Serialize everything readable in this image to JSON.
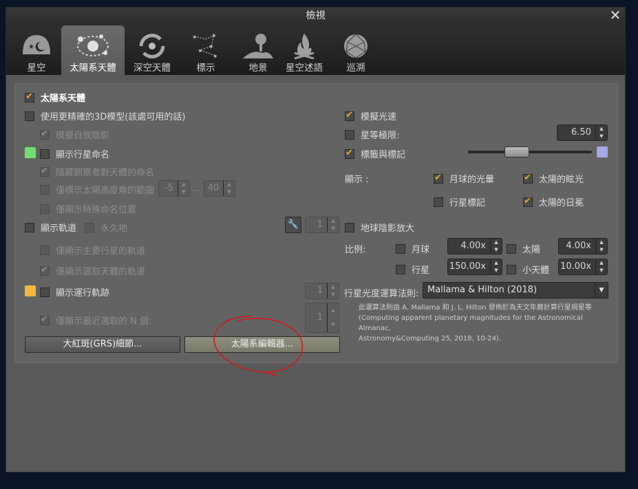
{
  "window": {
    "title": "檢視"
  },
  "tabs": [
    {
      "label": "星空",
      "icon": "sky-icon"
    },
    {
      "label": "太陽系天體",
      "icon": "solar-system-icon"
    },
    {
      "label": "深空天體",
      "icon": "galaxy-icon"
    },
    {
      "label": "標示",
      "icon": "constellation-icon"
    },
    {
      "label": "地景",
      "icon": "landscape-icon"
    },
    {
      "label": "星空述語",
      "icon": "campfire-icon"
    },
    {
      "label": "巡溯",
      "icon": "globe-icon"
    }
  ],
  "left": {
    "header": {
      "label": "太陽系天體",
      "checked": true
    },
    "accurate_3d": {
      "label": "使用更精確的3D模型(該處可用的話)",
      "checked": false
    },
    "self_shadow": {
      "label": "模擬自我陰影",
      "checked": true
    },
    "planet_labels": {
      "label": "顯示行星命名",
      "checked": false,
      "color": "#6fe06f"
    },
    "hide_observer_name": {
      "label": "隱藏觀察者對天體的命名",
      "checked": true
    },
    "altitude_range": {
      "label": "僅標示太陽高度角的範圍",
      "checked": false,
      "min": "-5",
      "sep": "...",
      "max": "40"
    },
    "special_positions": {
      "label": "僅顯示特殊命名位置",
      "checked": false
    },
    "orbits": {
      "label": "顯示軌道",
      "checked": false,
      "permanent_label": "永久地",
      "thickness": "1"
    },
    "major_orbits": {
      "label": "僅顯示主要行星的軌道",
      "checked": false
    },
    "selected_orbits": {
      "label": "僅顯示選取天體的軌道",
      "checked": true
    },
    "trails": {
      "label": "顯示運行軌跡",
      "checked": false,
      "color": "#f2b840",
      "thickness": "1"
    },
    "last_n": {
      "label": "僅顯示最近選取的 N 個:",
      "checked": true,
      "value": "1"
    },
    "grs_button": "大紅斑(GRS)細節...",
    "editor_button": "太陽系編輯器..."
  },
  "right": {
    "light_speed": {
      "label": "模擬光速",
      "checked": true
    },
    "mag_limit": {
      "label": "星等極限:",
      "checked": false,
      "value": "6.50"
    },
    "labels_markers": {
      "label": "標籤與標記",
      "checked": true,
      "color": "#a9a6e8",
      "slider_fraction": 0.36
    },
    "display": {
      "label": "顯示 :",
      "moon_halo": {
        "label": "月球的光暈",
        "checked": true
      },
      "sun_glare": {
        "label": "太陽的眩光",
        "checked": true
      },
      "planet_markers": {
        "label": "行星標記",
        "checked": false
      },
      "sun_corona": {
        "label": "太陽的日冕",
        "checked": true
      }
    },
    "earth_shadow": {
      "label": "地球陰影放大",
      "checked": false
    },
    "scale": {
      "label": "比例:",
      "moon": {
        "label": "月球",
        "checked": false,
        "value": "4.00x"
      },
      "sun": {
        "label": "太陽",
        "checked": false,
        "value": "4.00x"
      },
      "planets": {
        "label": "行星",
        "checked": false,
        "value": "150.00x"
      },
      "minor": {
        "label": "小天體",
        "checked": false,
        "value": "10.00x"
      }
    },
    "algorithm": {
      "label": "行星光度運算法則:",
      "value": "Mallama & Hilton (2018)"
    },
    "note": [
      "此運算法則由 A. Mallama 和 J. L. Hilton 發佈於為天文年曆計算行星視星等",
      "(Computing apparent planetary magnitudes for the Astronomical Almanac,",
      "Astronomy&Computing 25, 2018, 10-24)."
    ]
  }
}
